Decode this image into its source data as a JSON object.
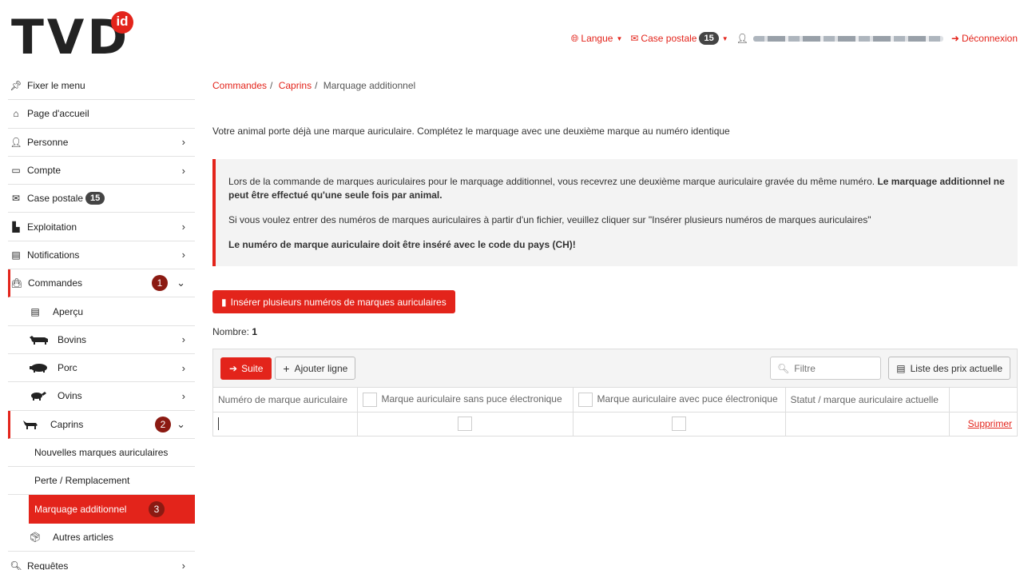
{
  "logo": {
    "text": "TVD",
    "badge": "id"
  },
  "topnav": {
    "language": "Langue",
    "mailbox": "Case postale",
    "mailbox_count": "15",
    "logout": "Déconnexion"
  },
  "sidebar": {
    "pin": "Fixer le menu",
    "home": "Page d'accueil",
    "person": "Personne",
    "account": "Compte",
    "mailbox": "Case postale",
    "mailbox_count": "15",
    "farm": "Exploitation",
    "notifications": "Notifications",
    "orders": "Commandes",
    "orders_badge": "1",
    "overview": "Aperçu",
    "cattle": "Bovins",
    "pigs": "Porc",
    "sheep": "Ovins",
    "goats": "Caprins",
    "goats_badge": "2",
    "new_tags": "Nouvelles marques auriculaires",
    "loss": "Perte / Remplacement",
    "additional": "Marquage additionnel",
    "additional_badge": "3",
    "other": "Autres articles",
    "queries": "Requêtes"
  },
  "breadcrumb": {
    "c1": "Commandes",
    "c2": "Caprins",
    "c3": "Marquage additionnel"
  },
  "intro": "Votre animal porte déjà une marque auriculaire. Complétez le marquage avec une deuxième marque au numéro identique",
  "alert": {
    "p1_text": "Lors de la commande de marques auriculaires pour le marquage additionnel, vous recevrez une deuxième marque auriculaire gravée du même numéro. ",
    "p1_bold": "Le marquage additionnel ne peut être effectué qu'une seule fois par animal.",
    "p2": "Si vous voulez entrer des numéros de marques auriculaires à partir d'un fichier, veuillez cliquer sur \"Insérer plusieurs numéros de marques auriculaires\"",
    "p3": "Le numéro de marque auriculaire doit être inséré avec le code du pays (CH)!"
  },
  "insert_button": "Insérer plusieurs numéros de marques auriculaires",
  "count": {
    "label": "Nombre: ",
    "value": "1"
  },
  "toolbar": {
    "next": "Suite",
    "add_row": "Ajouter ligne",
    "filter_placeholder": "Filtre",
    "price_list": "Liste des prix actuelle"
  },
  "table": {
    "col1": "Numéro de marque auriculaire",
    "col2": "Marque auriculaire sans puce électronique",
    "col3": "Marque auriculaire avec puce électronique",
    "col4": "Statut / marque auriculaire actuelle",
    "delete": "Supprimer"
  },
  "colors": {
    "accent": "#e3241b",
    "badge": "#8b1a12"
  }
}
